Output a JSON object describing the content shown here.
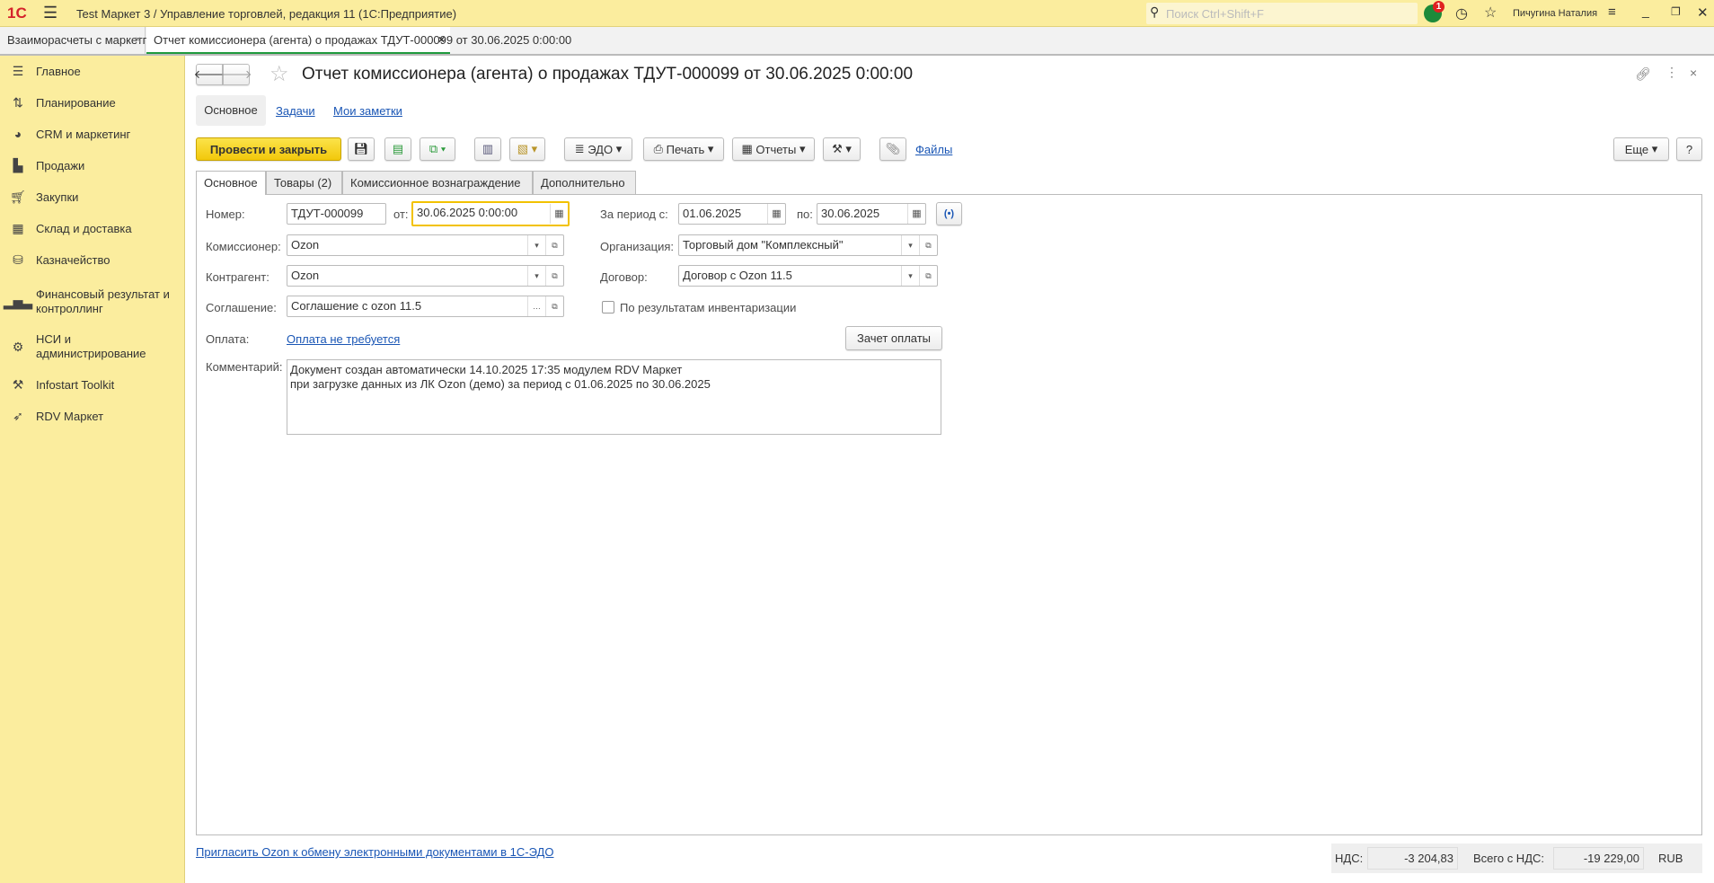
{
  "app": {
    "title": "Test Маркет 3 / Управление торговлей, редакция 11  (1С:Предприятие)",
    "search_placeholder": "Поиск Ctrl+Shift+F",
    "notification_count": "1",
    "user": "Пичугина Наталия"
  },
  "window_tabs": [
    {
      "label": "Взаиморасчеты с маркетплейсами"
    },
    {
      "label": "Отчет комиссионера (агента) о продажах ТДУТ-000099 от 30.06.2025 0:00:00"
    }
  ],
  "sidebar": {
    "items": [
      {
        "label": "Главное"
      },
      {
        "label": "Планирование"
      },
      {
        "label": "CRM и маркетинг"
      },
      {
        "label": "Продажи"
      },
      {
        "label": "Закупки"
      },
      {
        "label": "Склад и доставка"
      },
      {
        "label": "Казначейство"
      },
      {
        "label": "Финансовый результат и контроллинг"
      },
      {
        "label": "НСИ и администрирование"
      },
      {
        "label": "Infostart Toolkit"
      },
      {
        "label": "RDV Маркет"
      }
    ]
  },
  "document": {
    "title": "Отчет комиссионера (агента) о продажах ТДУТ-000099 от 30.06.2025 0:00:00",
    "subnav": [
      "Основное",
      "Задачи",
      "Мои заметки"
    ],
    "toolbar": {
      "post_close": "Провести и закрыть",
      "edo": "ЭДО",
      "print": "Печать",
      "reports": "Отчеты",
      "files": "Файлы",
      "more": "Еще",
      "help": "?"
    },
    "tabs": [
      "Основное",
      "Товары (2)",
      "Комиссионное вознаграждение",
      "Дополнительно"
    ],
    "form": {
      "number_label": "Номер:",
      "number": "ТДУТ-000099",
      "date_label": "от:",
      "date": "30.06.2025  0:00:00",
      "period_label": "За период с:",
      "period_from": "01.06.2025",
      "period_to_label": "по:",
      "period_to": "30.06.2025",
      "commissioner_label": "Комиссионер:",
      "commissioner": "Ozon",
      "organization_label": "Организация:",
      "organization": "Торговый дом \"Комплексный\"",
      "counterparty_label": "Контрагент:",
      "counterparty": "Ozon",
      "contract_label": "Договор:",
      "contract": "Договор с Ozon 11.5",
      "agreement_label": "Соглашение:",
      "agreement": "Соглашение с ozon 11.5",
      "inventory_label": "По результатам инвентаризации",
      "payment_label": "Оплата:",
      "payment_link": "Оплата не требуется",
      "offset_button": "Зачет оплаты",
      "comment_label": "Комментарий:",
      "comment_line1": "Документ создан автоматически 14.10.2025 17:35 модулем RDV Маркет",
      "comment_line2": "при загрузке данных из ЛК Ozon (демо) за период с 01.06.2025 по 30.06.2025"
    },
    "footer": {
      "invite_link": "Пригласить Ozon к обмену электронными документами в 1С-ЭДО",
      "vat_label": "НДС:",
      "vat": "-3 204,83",
      "total_label": "Всего с НДС:",
      "total": "-19 229,00",
      "currency": "RUB"
    }
  }
}
